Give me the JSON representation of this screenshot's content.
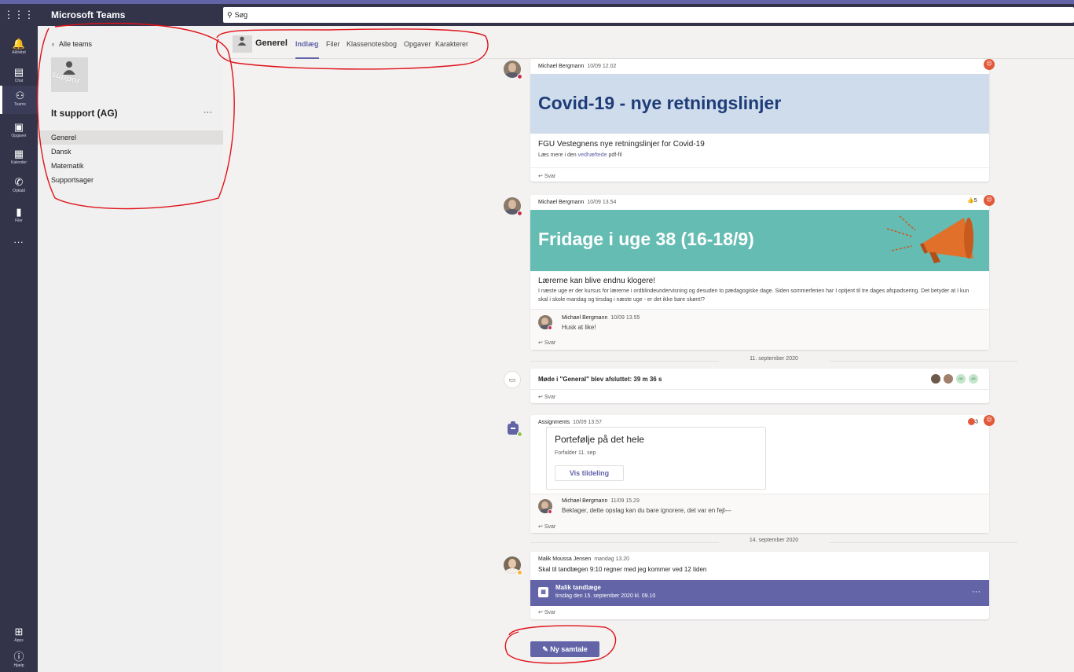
{
  "app": {
    "title": "Microsoft Teams",
    "waffle_icon": "waffle-icon"
  },
  "search": {
    "value": "Søg"
  },
  "rail": {
    "items": [
      {
        "label": "Aktivitet",
        "icon": "bell-icon"
      },
      {
        "label": "Chat",
        "icon": "chat-icon"
      },
      {
        "label": "Teams",
        "icon": "teams-icon"
      },
      {
        "label": "Opgaver",
        "icon": "assignments-icon"
      },
      {
        "label": "Kalender",
        "icon": "calendar-icon"
      },
      {
        "label": "Opkald",
        "icon": "phone-icon"
      },
      {
        "label": "Filer",
        "icon": "files-icon"
      }
    ],
    "more": "...",
    "apps_label": "Apps",
    "help_label": "Hjælp"
  },
  "teampanel": {
    "back_label": "Alle teams",
    "logo_text": "suppor",
    "team_name": "It support (AG)",
    "more": "···",
    "channels": [
      "Generel",
      "Dansk",
      "Matematik",
      "Supportsager"
    ]
  },
  "channel_header": {
    "name": "Generel",
    "tabs": [
      "Indlæg",
      "Filer",
      "Klassenotesbog",
      "Opgaver",
      "Karakterer"
    ]
  },
  "messages": {
    "m1": {
      "author": "Michael Bergmann",
      "time": "10/09 12.02",
      "banner_title": "Covid-19 - nye retningslinjer",
      "subtitle": "FGU Vestegnens nye retningslinjer for Covid-19",
      "body_pre": "Læs mere i den ",
      "body_link": "vedhæftede",
      "body_post": " pdf-fil",
      "reply": "Svar"
    },
    "m2": {
      "author": "Michael Bergmann",
      "time": "10/09 13.54",
      "reaction_count": "5",
      "banner_title": "Fridage i uge 38 (16-18/9)",
      "subtitle": "Lærerne kan blive endnu klogere!",
      "body": "I næste uge er der kursus for lærerne i ordblindeundervisning og desuden to pædagogiske dage. Siden sommerferien har I optjent til tre dages afspadsering. Det betyder at I kun skal i skole mandag og tirsdag i næste uge - er det ikke bare skønt!?",
      "reply_author": "Michael Bergmann",
      "reply_time": "10/09 13.55",
      "reply_text": "Husk at like!",
      "reply": "Svar"
    },
    "date1": "11. september 2020",
    "m3": {
      "text": "Møde i \"General\" blev afsluttet: 39 m 36 s",
      "participants": [
        "",
        "",
        "DK",
        "AS"
      ],
      "reply": "Svar"
    },
    "m4": {
      "author": "Assignments",
      "time": "10/09 13.57",
      "reaction_count": "3",
      "assignment_title": "Portefølje på det hele",
      "due": "Forfalder 11. sep",
      "button": "Vis tildeling",
      "reply_author": "Michael Bergmann",
      "reply_time": "11/09 15.29",
      "reply_text": "Beklager, dette opslag kan du bare ignorere, det var en fejl---",
      "reply": "Svar"
    },
    "date2": "14. september 2020",
    "m5": {
      "author": "Malik Moussa Jensen",
      "time": "mandag 13.20",
      "text": "Skal til tandlægen 9:10 regner med jeg kommer ved 12 tiden",
      "event_title": "Malik tandlæge",
      "event_time": "tirsdag den 15. september 2020 kl. 09.10",
      "event_more": "···",
      "reply": "Svar"
    }
  },
  "new_conversation": "Ny samtale",
  "colors": {
    "brand": "#6264a7",
    "rail": "#33344a",
    "annotation": "#e0121a",
    "reaction_red": "#e25a3b"
  }
}
